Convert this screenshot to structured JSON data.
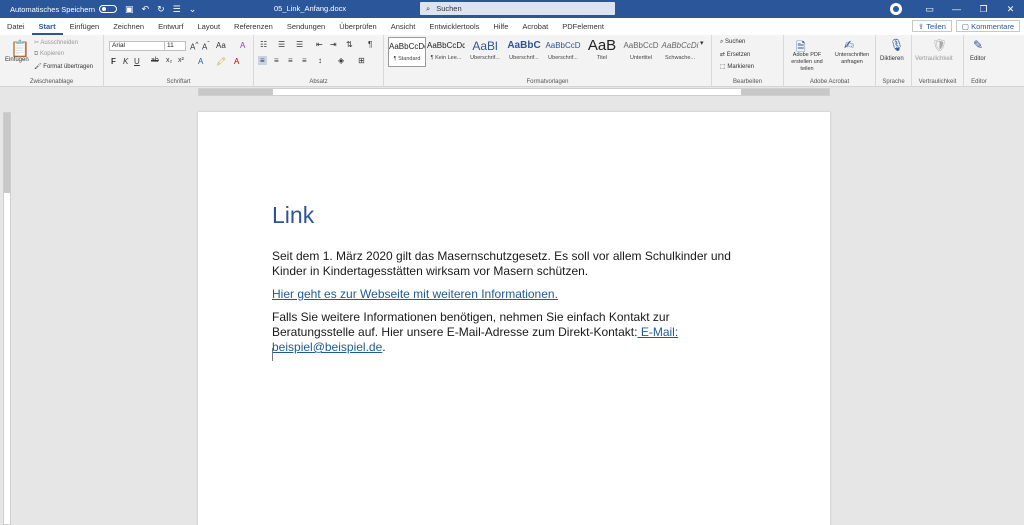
{
  "titlebar": {
    "autosave": "Automatisches Speichern",
    "doc_title": "05_Link_Anfang.docx",
    "search": "Suchen"
  },
  "menu": {
    "tabs": [
      "Datei",
      "Start",
      "Einfügen",
      "Zeichnen",
      "Entwurf",
      "Layout",
      "Referenzen",
      "Sendungen",
      "Überprüfen",
      "Ansicht",
      "Entwicklertools",
      "Hilfe",
      "Acrobat",
      "PDFelement"
    ],
    "active": "Start",
    "share": "Teilen",
    "comments": "Kommentare"
  },
  "ribbon": {
    "clipboard": {
      "label": "Zwischenablage",
      "paste": "Einfügen",
      "cut": "Ausschneiden",
      "copy": "Kopieren",
      "format_painter": "Format übertragen"
    },
    "font": {
      "label": "Schriftart",
      "font_name": "Arial",
      "font_size": "11"
    },
    "paragraph": {
      "label": "Absatz"
    },
    "styles": {
      "label": "Formatvorlagen",
      "items": [
        {
          "preview": "AaBbCcDd",
          "name": "¶ Standard"
        },
        {
          "preview": "AaBbCcDd",
          "name": "¶ Kein Lee..."
        },
        {
          "preview": "AaBl",
          "name": "Überschrif..."
        },
        {
          "preview": "AaBbC",
          "name": "Überschrif..."
        },
        {
          "preview": "AaBbCcD",
          "name": "Überschrif..."
        },
        {
          "preview": "AaB",
          "name": "Titel"
        },
        {
          "preview": "AaBbCcD",
          "name": "Untertitel"
        },
        {
          "preview": "AaBbCcDi",
          "name": "Schwache..."
        }
      ]
    },
    "editing": {
      "label": "Bearbeiten",
      "find": "Suchen",
      "replace": "Ersetzen",
      "select": "Markieren"
    },
    "acrobat": {
      "label": "Adobe Acrobat",
      "create_pdf": "Adobe PDF erstellen und teilen",
      "sign": "Unterschriften anfragen"
    },
    "voice": {
      "label": "Sprache",
      "dictate": "Diktieren"
    },
    "sensitivity": {
      "label": "Vertraulichkeit",
      "btn": "Vertraulichkeit"
    },
    "editor": {
      "label": "Editor",
      "btn": "Editor"
    }
  },
  "document": {
    "heading": "Link",
    "p1": "Seit dem 1. März 2020 gilt das Masernschutzgesetz. Es soll vor allem Schulkinder und Kinder in Kindertagesstätten wirksam vor Masern schützen.",
    "link1": "Hier geht es zur Webseite mit weiteren Informationen.",
    "p3_text": "Falls Sie weitere Informationen benötigen, nehmen Sie einfach Kontakt zur Beratungsstelle auf. Hier unsere E-Mail-Adresse zum Direkt-Kontakt:",
    "p3_link": " E-Mail: beispiel@beispiel.de",
    "p3_end": "."
  },
  "colors": {
    "accent": "#2b579a",
    "heading": "#2f5496",
    "link": "#1f5b97"
  }
}
